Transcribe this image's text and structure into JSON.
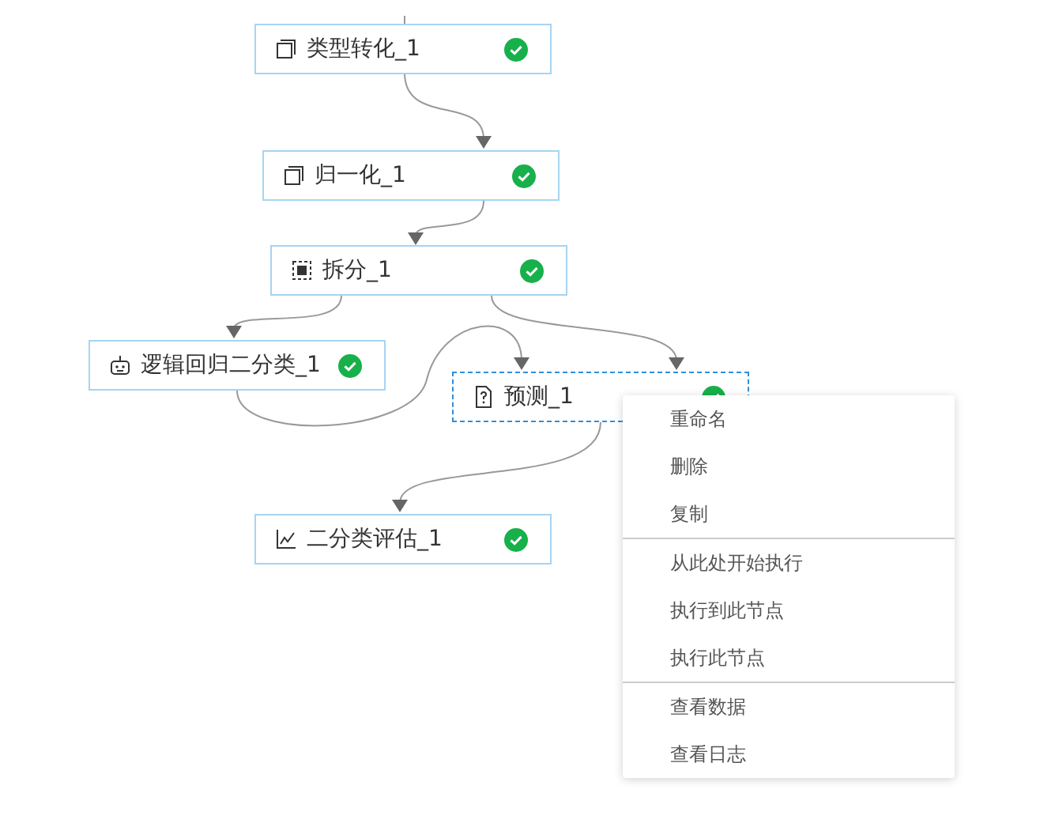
{
  "nodes": [
    {
      "label": "类型转化_1",
      "kind": "copy",
      "succeeded": true,
      "selected": false
    },
    {
      "label": "归一化_1",
      "kind": "copy",
      "succeeded": true,
      "selected": false
    },
    {
      "label": "拆分_1",
      "kind": "split",
      "succeeded": true,
      "selected": false
    },
    {
      "label": "逻辑回归二分类_1",
      "kind": "robot",
      "succeeded": true,
      "selected": false
    },
    {
      "label": "预测_1",
      "kind": "file",
      "succeeded": true,
      "selected": true
    },
    {
      "label": "二分类评估_1",
      "kind": "chart",
      "succeeded": true,
      "selected": false
    }
  ],
  "context_menu": {
    "groups": [
      [
        "重命名",
        "删除",
        "复制"
      ],
      [
        "从此处开始执行",
        "执行到此节点",
        "执行此节点"
      ],
      [
        "查看数据",
        "查看日志"
      ]
    ]
  }
}
